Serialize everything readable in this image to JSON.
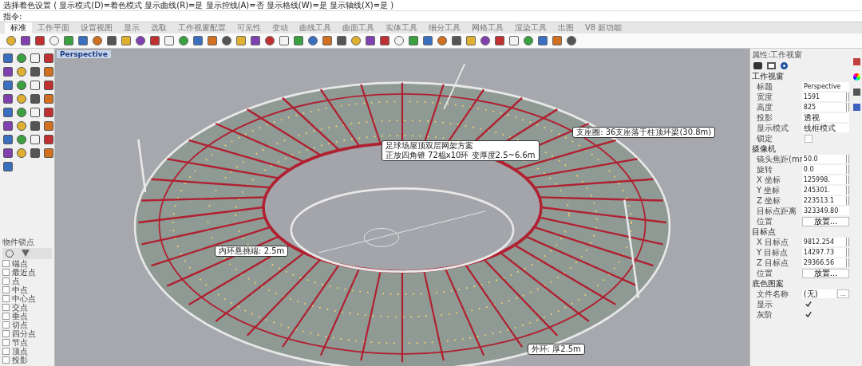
{
  "command_history": "选择着色设置 ( 显示模式(D)=着色模式  显示曲线(R)=是  显示控线(A)=否  显示格线(W)=是  显示轴线(X)=是 )",
  "command_prompt": "指令:",
  "tabs": [
    {
      "label": "标准",
      "selected": true
    },
    {
      "label": "工作平面",
      "selected": false
    },
    {
      "label": "设置视图",
      "selected": false
    },
    {
      "label": "显示",
      "selected": false
    },
    {
      "label": "选取",
      "selected": false
    },
    {
      "label": "工作视窗配置",
      "selected": false
    },
    {
      "label": "可见性",
      "selected": false
    },
    {
      "label": "变动",
      "selected": false
    },
    {
      "label": "曲线工具",
      "selected": false
    },
    {
      "label": "曲面工具",
      "selected": false
    },
    {
      "label": "实体工具",
      "selected": false
    },
    {
      "label": "细分工具",
      "selected": false
    },
    {
      "label": "网格工具",
      "selected": false
    },
    {
      "label": "渲染工具",
      "selected": false
    },
    {
      "label": "出图",
      "selected": false
    },
    {
      "label": "V8 新功能",
      "selected": false
    }
  ],
  "osnap_panel": {
    "title": "物件锁点",
    "items": [
      {
        "label": "端点",
        "checked": false
      },
      {
        "label": "最近点",
        "checked": false
      },
      {
        "label": "点",
        "checked": false
      },
      {
        "label": "中点",
        "checked": false
      },
      {
        "label": "中心点",
        "checked": false
      },
      {
        "label": "交点",
        "checked": false
      },
      {
        "label": "垂点",
        "checked": false
      },
      {
        "label": "切点",
        "checked": false
      },
      {
        "label": "四分点",
        "checked": false
      },
      {
        "label": "节点",
        "checked": false
      },
      {
        "label": "顶点",
        "checked": false
      },
      {
        "label": "投影",
        "checked": false
      }
    ]
  },
  "viewport": {
    "title": "Perspective",
    "annotations": [
      {
        "lines": [
          "足球场屋顶双层网架方案",
          "正放四角锥 72榀x10环 变厚度2.5~6.6m"
        ]
      },
      {
        "lines": [
          "支座圈: 36支座落于柱顶环梁(30.8m)"
        ]
      },
      {
        "lines": [
          "内环悬挑端: 2.5m"
        ]
      },
      {
        "lines": [
          "外环: 厚2.5m"
        ]
      }
    ]
  },
  "properties": {
    "title": "属性:工作视窗",
    "sections": [
      {
        "title": "工作视窗",
        "rows": [
          {
            "kind": "text",
            "label": "标题",
            "value": "Perspective"
          },
          {
            "kind": "spin",
            "label": "宽度",
            "value": "1591"
          },
          {
            "kind": "spin",
            "label": "高度",
            "value": "825"
          },
          {
            "kind": "select",
            "label": "投影",
            "value": "透视"
          },
          {
            "kind": "select",
            "label": "显示模式",
            "value": "线框模式"
          },
          {
            "kind": "check",
            "label": "锁定",
            "checked": false
          }
        ]
      },
      {
        "title": "摄像机",
        "rows": [
          {
            "kind": "spin",
            "label": "镜头焦距(mr",
            "value": "50.0"
          },
          {
            "kind": "spin",
            "label": "旋转",
            "value": "0.0"
          },
          {
            "kind": "spin",
            "label": "X 坐标",
            "value": "125998."
          },
          {
            "kind": "spin",
            "label": "Y 坐标",
            "value": "245301."
          },
          {
            "kind": "spin",
            "label": "Z 坐标",
            "value": "223513.1"
          },
          {
            "kind": "text",
            "label": "目标点距离",
            "value": "323349.80"
          },
          {
            "kind": "button",
            "label": "位置",
            "value": "放置..."
          }
        ]
      },
      {
        "title": "目标点",
        "rows": [
          {
            "kind": "spin",
            "label": "X 目标点",
            "value": "9812.254"
          },
          {
            "kind": "spin",
            "label": "Y 目标点",
            "value": "14297.73"
          },
          {
            "kind": "spin",
            "label": "Z 目标点",
            "value": "29366.56"
          },
          {
            "kind": "button",
            "label": "位置",
            "value": "放置..."
          }
        ]
      },
      {
        "title": "底色图案",
        "rows": [
          {
            "kind": "file",
            "label": "文件名称",
            "value": "(无)",
            "button": "..."
          },
          {
            "kind": "check",
            "label": "显示",
            "checked": true
          },
          {
            "kind": "check",
            "label": "灰阶",
            "checked": true
          }
        ]
      }
    ]
  }
}
